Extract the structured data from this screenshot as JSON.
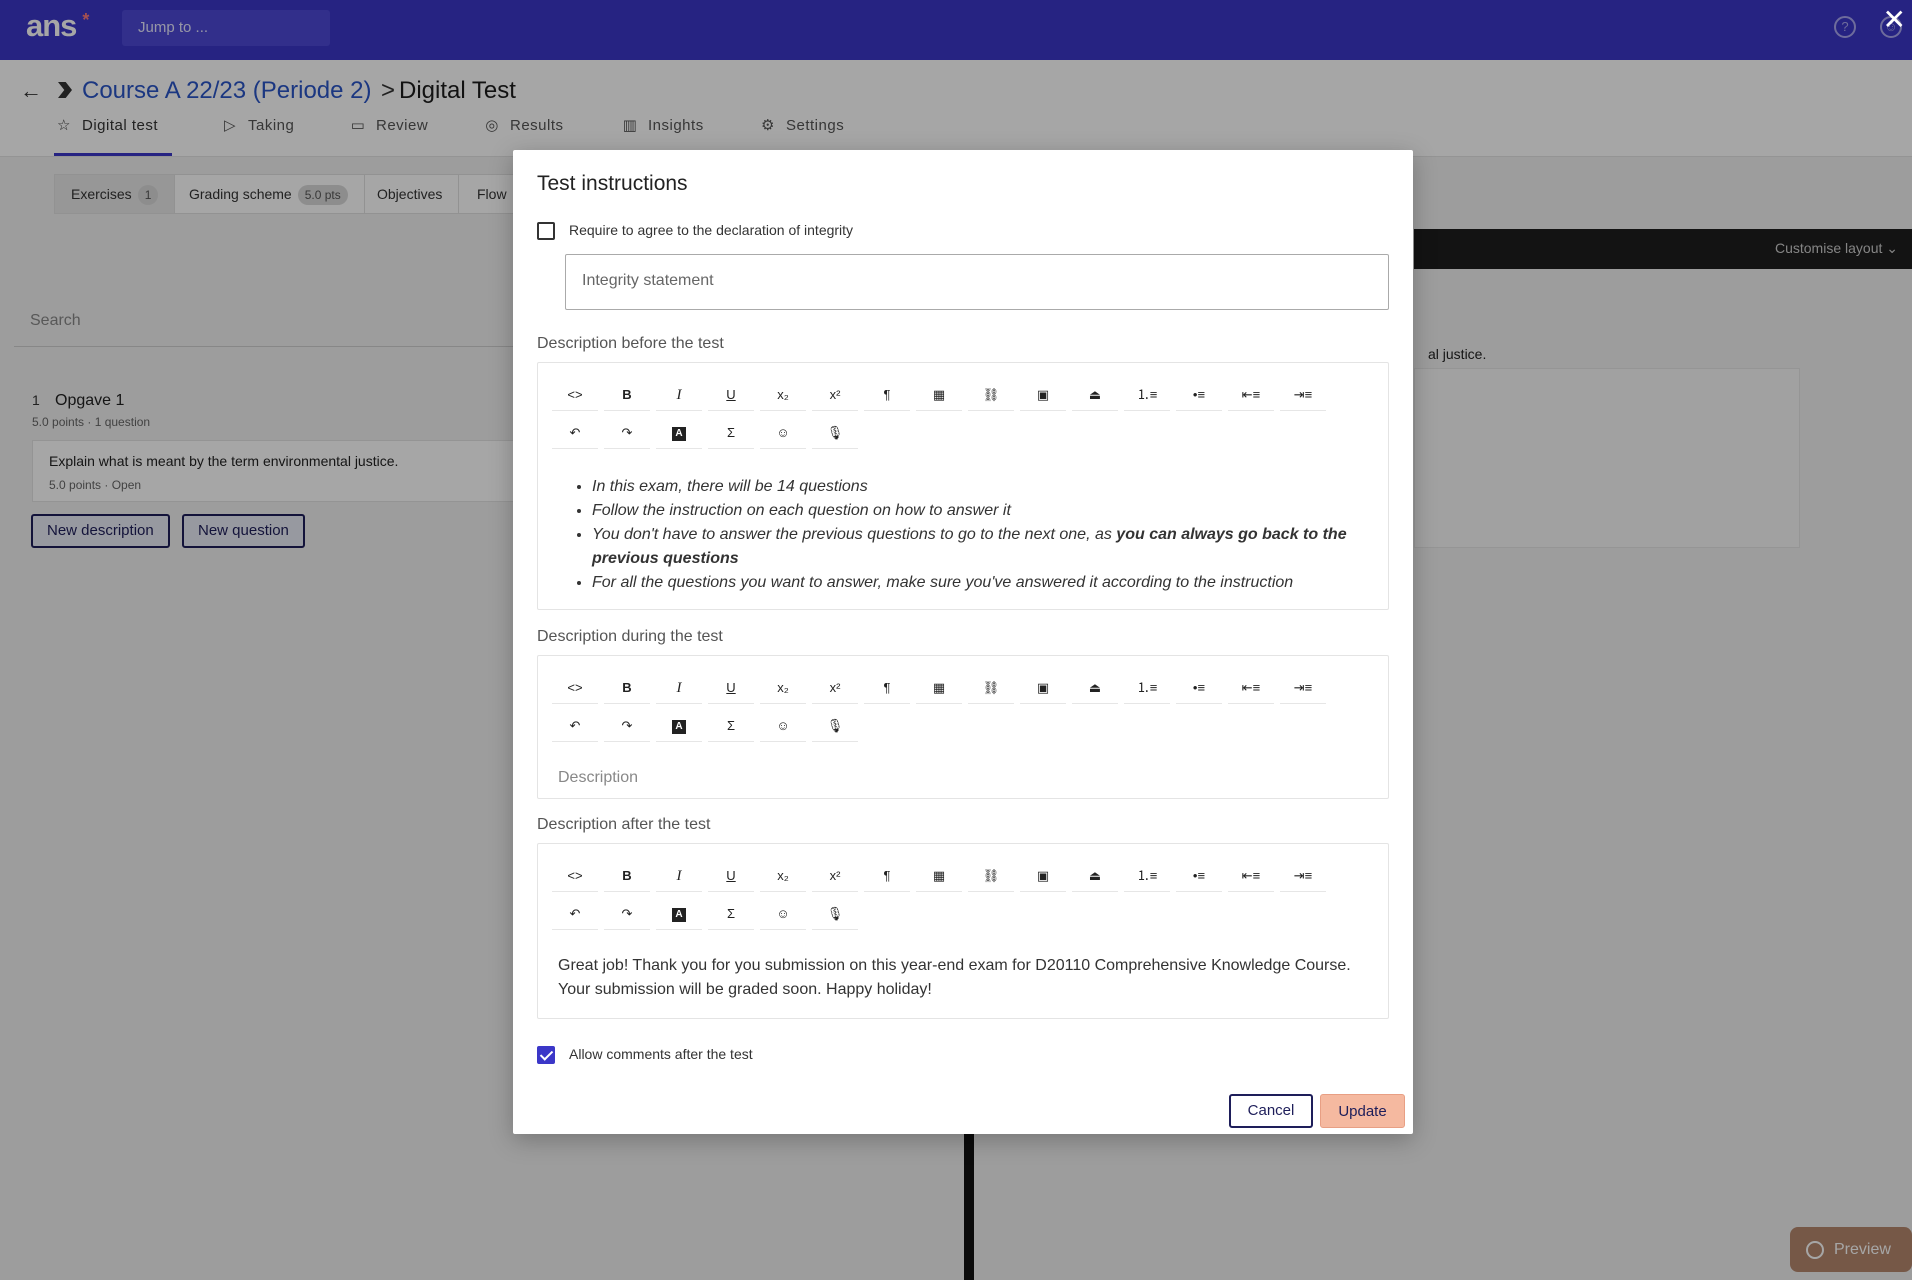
{
  "topbar": {
    "logo": "ans",
    "logo_mark": "*",
    "jump_placeholder": "Jump to ...",
    "help_icon": "help-icon",
    "account_icon": "account-icon"
  },
  "breadcrumb": {
    "course": "Course A 22/23 (Periode 2)",
    "separator": ">",
    "current": "Digital Test"
  },
  "tabs": [
    {
      "label": "Digital test",
      "icon": "star-icon",
      "active": true
    },
    {
      "label": "Taking",
      "icon": "play-icon"
    },
    {
      "label": "Review",
      "icon": "comment-icon"
    },
    {
      "label": "Results",
      "icon": "badge-icon"
    },
    {
      "label": "Insights",
      "icon": "chart-icon"
    },
    {
      "label": "Settings",
      "icon": "gear-icon"
    }
  ],
  "subtabs": {
    "exercises": "Exercises",
    "exercises_count": "1",
    "grading": "Grading scheme",
    "grading_pts": "5.0 pts",
    "objectives": "Objectives",
    "flow": "Flow"
  },
  "left_panel": {
    "search_placeholder": "Search",
    "exercise_number": "1",
    "exercise_title": "Opgave 1",
    "exercise_meta": "5.0 points · 1 question",
    "question_text": "Explain what is meant by the term environmental justice.",
    "question_meta": "5.0 points · Open",
    "new_description": "New description",
    "new_question": "New question"
  },
  "right_panel": {
    "customise_layout": "Customise layout",
    "partial_text": "al justice."
  },
  "preview_label": "Preview",
  "modal": {
    "title": "Test instructions",
    "integrity_checkbox_label": "Require to agree to the declaration of integrity",
    "integrity_checked": false,
    "integrity_placeholder": "Integrity statement",
    "before_label": "Description before the test",
    "before_items": [
      "In this exam, there will be 14 questions",
      "Follow the instruction on each question on how to answer it",
      "You don't have to answer the previous questions to go to the next one, as ",
      "you can always go back to the previous questions",
      "For all the questions you want to answer, make sure you've answered it according to the instruction"
    ],
    "during_label": "Description during the test",
    "during_placeholder": "Description",
    "after_label": "Description after the test",
    "after_text": "Great job! Thank you for you submission on this year-end exam for D20110 Comprehensive Knowledge Course. Your submission will be graded soon. Happy holiday!",
    "allow_comments_label": "Allow comments after the test",
    "allow_comments_checked": true,
    "cancel": "Cancel",
    "update": "Update"
  },
  "toolbar_row1": [
    "<>",
    "B",
    "I",
    "U",
    "x₂",
    "x²",
    "¶",
    "▦",
    "⛓",
    "▣",
    "⏏",
    "1≡",
    "•≡",
    "⇤≡",
    "⇥≡"
  ],
  "toolbar_row2": [
    "↶",
    "↷",
    "A",
    "Σ",
    "☺",
    "🎙"
  ]
}
